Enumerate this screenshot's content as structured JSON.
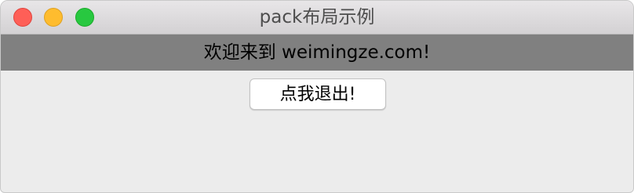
{
  "window": {
    "title": "pack布局示例"
  },
  "banner": {
    "text": "欢迎来到 weimingze.com!"
  },
  "quit_button": {
    "label": "点我退出!"
  },
  "colors": {
    "close": "#fe5f57",
    "minimize": "#febc2e",
    "zoom": "#28c840",
    "banner_background": "#808080",
    "window_background": "#ececec"
  },
  "icons": {
    "close": "close-icon",
    "minimize": "minimize-icon",
    "zoom": "zoom-icon"
  }
}
